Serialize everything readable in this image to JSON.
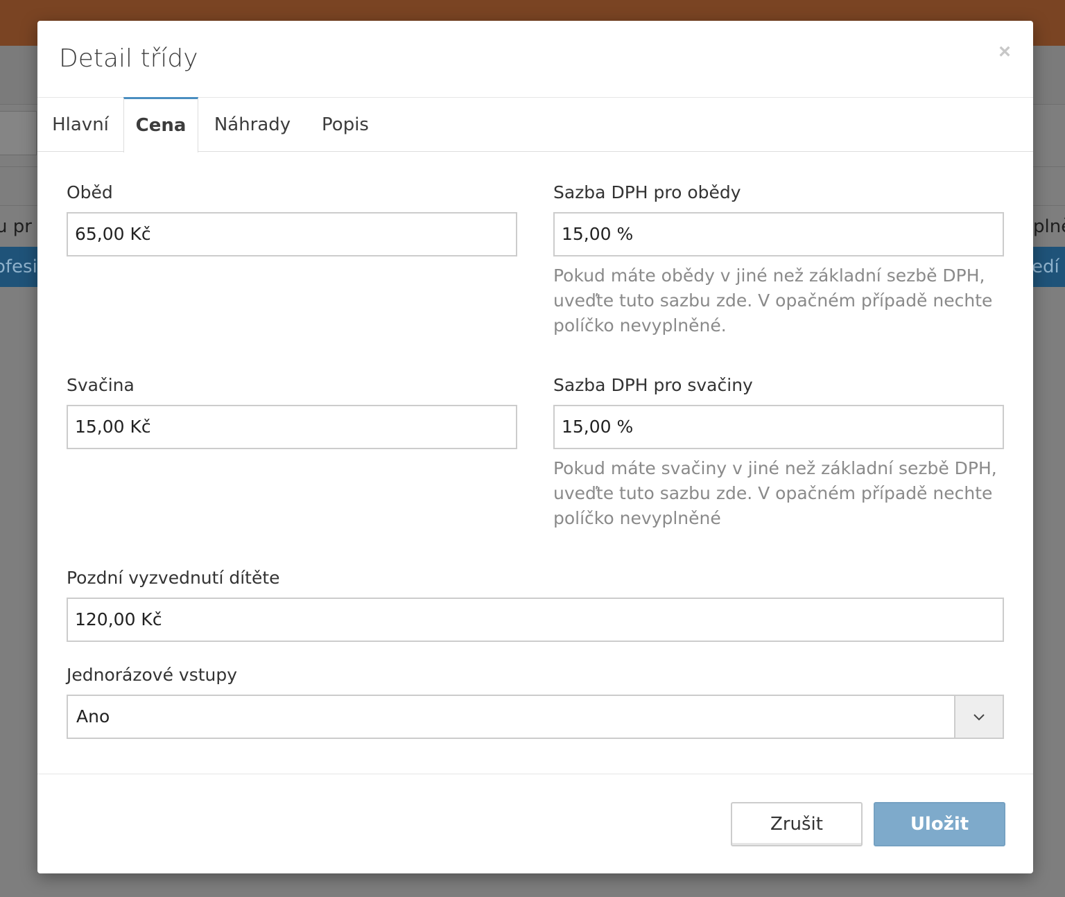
{
  "background": {
    "row_text_left": "u pr",
    "row_text_right": "plně",
    "blue_text_left": "ofesi",
    "blue_text_right": "edí p"
  },
  "modal": {
    "title": "Detail třídy",
    "close_label": "×"
  },
  "tabs": [
    {
      "label": "Hlavní",
      "active": false
    },
    {
      "label": "Cena",
      "active": true
    },
    {
      "label": "Náhrady",
      "active": false
    },
    {
      "label": "Popis",
      "active": false
    }
  ],
  "form": {
    "lunch": {
      "label": "Oběd",
      "value": "65,00 Kč"
    },
    "lunch_vat": {
      "label": "Sazba DPH pro obědy",
      "value": "15,00 %",
      "help": "Pokud máte obědy v jiné než základní sezbě DPH, uveďte tuto sazbu zde. V opačném případě nechte políčko nevyplněné."
    },
    "snack": {
      "label": "Svačina",
      "value": "15,00 Kč"
    },
    "snack_vat": {
      "label": "Sazba DPH pro svačiny",
      "value": "15,00 %",
      "help": "Pokud máte svačiny v jiné než základní sezbě DPH, uveďte tuto sazbu zde. V opačném případě nechte políčko nevyplněné"
    },
    "late_pickup": {
      "label": "Pozdní vyzvednutí dítěte",
      "value": "120,00 Kč"
    },
    "single_entries": {
      "label": "Jednorázové vstupy",
      "value": "Ano"
    }
  },
  "footer": {
    "cancel_label": "Zrušit",
    "save_label": "Uložit"
  },
  "colors": {
    "accent": "#4a8ec0",
    "save_button": "#7eaacb",
    "top_bar": "#7a4423",
    "blue_bar": "#1f5379"
  }
}
